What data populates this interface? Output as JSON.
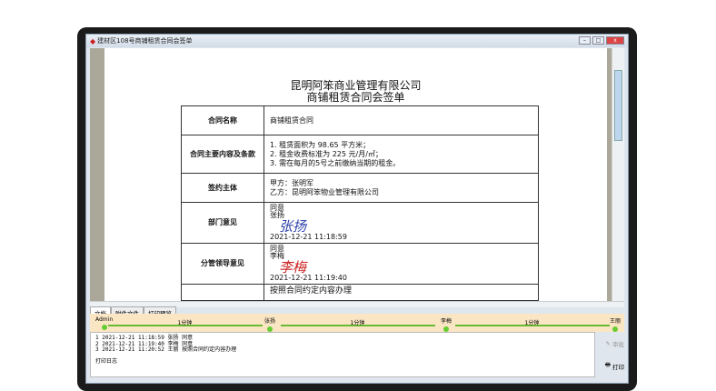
{
  "window": {
    "title": "建材区108号商铺租赁合同会签单",
    "controls": [
      "minimize",
      "maximize",
      "close"
    ]
  },
  "document": {
    "company": "昆明阿笨商业管理有限公司",
    "form_title": "商铺租赁合同会签单",
    "rows": [
      {
        "label": "合同名称",
        "value": "商铺租赁合同"
      },
      {
        "label": "合同主要内容及条款",
        "lines": [
          "1. 租赁面积为 98.65 平方米；",
          "2. 租金收费标准为 225 元/月/㎡；",
          "3. 需在每月的5号之前缴纳当期的租金。"
        ]
      },
      {
        "label": "签约主体",
        "lines": [
          "甲方：张明军",
          "乙方：昆明阿笨物业管理有限公司"
        ]
      },
      {
        "label": "部门意见",
        "opinion": "同意",
        "signer": "张扬",
        "signature": "张扬",
        "time": "2021-12-21 11:18:59"
      },
      {
        "label": "分管领导意见",
        "opinion": "同意",
        "signer": "李梅",
        "signature": "李梅",
        "time": "2021-12-21 11:19:40"
      },
      {
        "label": "",
        "value": "按照合同约定内容办理"
      }
    ]
  },
  "tabs": [
    "文档",
    "附件文件",
    "打印预览"
  ],
  "timeline": {
    "nodes": [
      "Admin",
      "张扬",
      "李梅",
      "王丽"
    ],
    "durations": [
      "1分钟",
      "1分钟",
      "1分钟"
    ]
  },
  "log": [
    {
      "no": "1",
      "time": "2021-12-21 11:18:59",
      "user": "张扬",
      "action": "同意"
    },
    {
      "no": "2",
      "time": "2021-12-21 11:19:40",
      "user": "李梅",
      "action": "同意"
    },
    {
      "no": "3",
      "time": "2021-12-21 11:20:52",
      "user": "王丽",
      "action": "按照合同约定内容办理"
    }
  ],
  "print_log_link": "打印日志",
  "buttons": {
    "approve": "审批",
    "print": "打印"
  }
}
